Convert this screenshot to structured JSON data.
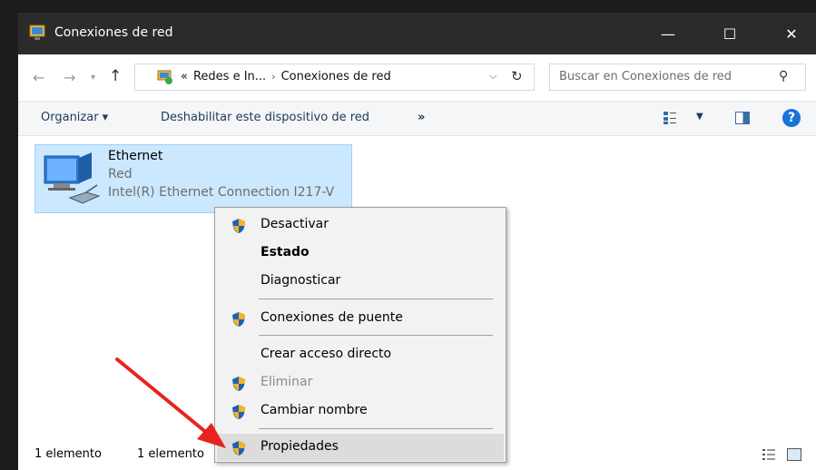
{
  "window": {
    "title": "Conexiones de red",
    "controls": {
      "minimize": "—",
      "maximize": "☐",
      "close": "✕"
    }
  },
  "address": {
    "crumbs": [
      "«",
      "Redes e In...",
      "›",
      "Conexiones de red"
    ],
    "search_placeholder": "Buscar en Conexiones de red"
  },
  "commandbar": {
    "organize": "Organizar ▾",
    "disable": "Deshabilitar este dispositivo de red",
    "more": "»",
    "view_dropdown": "▼",
    "help": "?"
  },
  "item": {
    "name": "Ethernet",
    "network": "Red",
    "adapter": "Intel(R) Ethernet Connection I217-V"
  },
  "statusbar": {
    "count": "1 elemento",
    "selected": "1 elemento"
  },
  "context_menu": {
    "items": [
      {
        "label": "Desactivar",
        "shield": true
      },
      {
        "label": "Estado",
        "bold": true
      },
      {
        "label": "Diagnosticar"
      },
      {
        "label": "Conexiones de puente",
        "shield": true
      },
      {
        "label": "Crear acceso directo"
      },
      {
        "label": "Eliminar",
        "shield": true,
        "disabled": true
      },
      {
        "label": "Cambiar nombre",
        "shield": true
      },
      {
        "label": "Propiedades",
        "shield": true,
        "highlighted": true
      }
    ]
  },
  "colors": {
    "titlebar": "#2b2b2b",
    "selection": "#cce8ff",
    "annotation_arrow": "#e8231f"
  }
}
